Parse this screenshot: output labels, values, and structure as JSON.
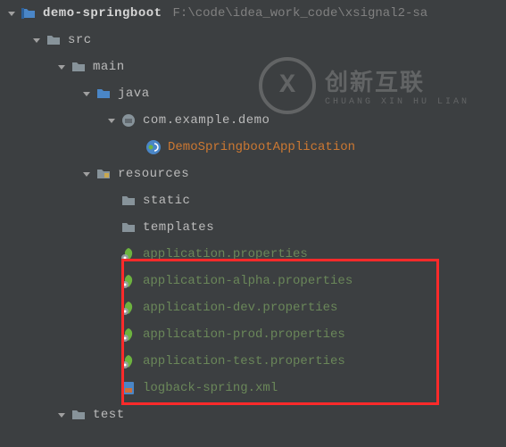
{
  "project": {
    "name": "demo-springboot",
    "path": "F:\\code\\idea_work_code\\xsignal2-sa"
  },
  "tree": {
    "src": "src",
    "main": "main",
    "java": "java",
    "package": "com.example.demo",
    "app_class": "DemoSpringbootApplication",
    "resources": "resources",
    "static": "static",
    "templates": "templates",
    "props": [
      "application.properties",
      "application-alpha.properties",
      "application-dev.properties",
      "application-prod.properties",
      "application-test.properties"
    ],
    "logback": "logback-spring.xml",
    "test": "test"
  },
  "watermark": {
    "title": "创新互联",
    "subtitle": "CHUANG XIN HU LIAN"
  }
}
